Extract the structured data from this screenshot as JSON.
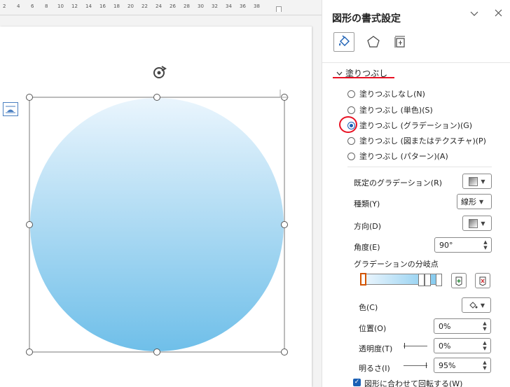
{
  "ruler": {
    "numbers": [
      "2",
      "4",
      "6",
      "8",
      "10",
      "12",
      "14",
      "16",
      "18",
      "20",
      "22",
      "24",
      "26",
      "28",
      "30",
      "32",
      "34",
      "36",
      "38"
    ]
  },
  "pane": {
    "title": "図形の書式設定",
    "section_fill": "塗りつぶし",
    "fill_options": [
      {
        "label": "塗りつぶしなし(N)",
        "selected": false
      },
      {
        "label": "塗りつぶし (単色)(S)",
        "selected": false
      },
      {
        "label": "塗りつぶし (グラデーション)(G)",
        "selected": true
      },
      {
        "label": "塗りつぶし (図またはテクスチャ)(P)",
        "selected": false
      },
      {
        "label": "塗りつぶし (パターン)(A)",
        "selected": false
      }
    ],
    "preset_gradient_label": "既定のグラデーション(R)",
    "type_label": "種類(Y)",
    "type_value": "線形",
    "direction_label": "方向(D)",
    "angle_label": "角度(E)",
    "angle_value": "90°",
    "stops_label": "グラデーションの分岐点",
    "color_label": "色(C)",
    "position_label": "位置(O)",
    "position_value": "0%",
    "transparency_label": "透明度(T)",
    "transparency_value": "0%",
    "brightness_label": "明るさ(I)",
    "brightness_value": "95%",
    "rotate_with_shape_label": "図形に合わせて回転する(W)"
  },
  "shape": {
    "gradient_top": "#eaf5fd",
    "gradient_bottom": "#6fbfe9"
  },
  "colors": {
    "accent": "#1a5fb4",
    "highlight": "#e81123"
  }
}
